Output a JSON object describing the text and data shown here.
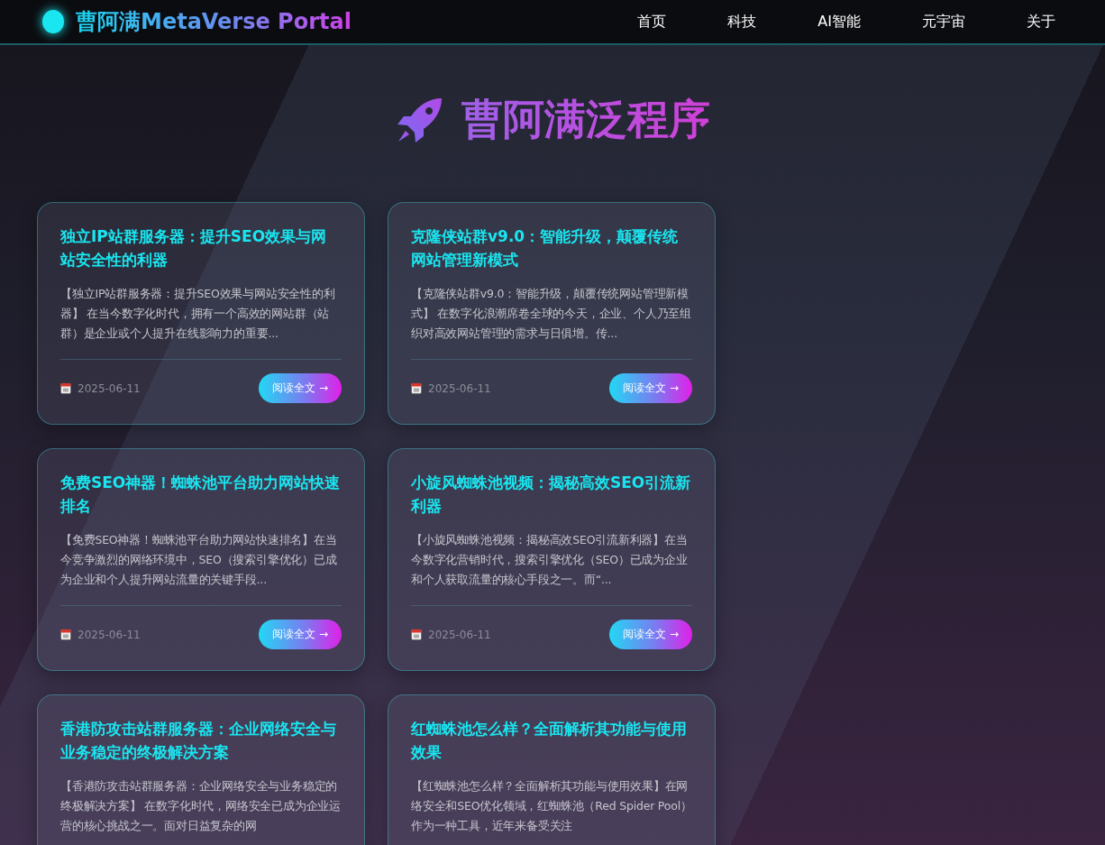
{
  "header": {
    "brand": "曹阿满MetaVerse Portal",
    "nav": [
      {
        "label": "首页"
      },
      {
        "label": "科技"
      },
      {
        "label": "AI智能"
      },
      {
        "label": "元宇宙"
      },
      {
        "label": "关于"
      }
    ]
  },
  "hero": {
    "title": "曹阿满泛程序"
  },
  "articles": [
    {
      "title": "独立IP站群服务器：提升SEO效果与网站安全性的利器",
      "excerpt": "【独立IP站群服务器：提升SEO效果与网站安全性的利器】 在当今数字化时代，拥有一个高效的网站群（站群）是企业或个人提升在线影响力的重要...",
      "date": "2025-06-11",
      "button": "阅读全文 →"
    },
    {
      "title": "克隆侠站群v9.0：智能升级，颠覆传统网站管理新模式",
      "excerpt": "【克隆侠站群v9.0：智能升级，颠覆传统网站管理新模式】 在数字化浪潮席卷全球的今天，企业、个人乃至组织对高效网站管理的需求与日俱增。传...",
      "date": "2025-06-11",
      "button": "阅读全文 →"
    },
    {
      "title": "免费SEO神器！蜘蛛池平台助力网站快速排名",
      "excerpt": "【免费SEO神器！蜘蛛池平台助力网站快速排名】在当今竞争激烈的网络环境中，SEO（搜索引擎优化）已成为企业和个人提升网站流量的关键手段...",
      "date": "2025-06-11",
      "button": "阅读全文 →"
    },
    {
      "title": "小旋风蜘蛛池视频：揭秘高效SEO引流新利器",
      "excerpt": "【小旋风蜘蛛池视频：揭秘高效SEO引流新利器】在当今数字化营销时代，搜索引擎优化（SEO）已成为企业和个人获取流量的核心手段之一。而“...",
      "date": "2025-06-11",
      "button": "阅读全文 →"
    },
    {
      "title": "香港防攻击站群服务器：企业网络安全与业务稳定的终极解决方案",
      "excerpt": "【香港防攻击站群服务器：企业网络安全与业务稳定的终极解决方案】 在数字化时代，网络安全已成为企业运营的核心挑战之一。面对日益复杂的网"
    },
    {
      "title": "红蜘蛛池怎么样？全面解析其功能与使用效果",
      "excerpt": "【红蜘蛛池怎么样？全面解析其功能与使用效果】在网络安全和SEO优化领域，红蜘蛛池（Red Spider Pool）作为一种工具，近年来备受关注"
    }
  ]
}
